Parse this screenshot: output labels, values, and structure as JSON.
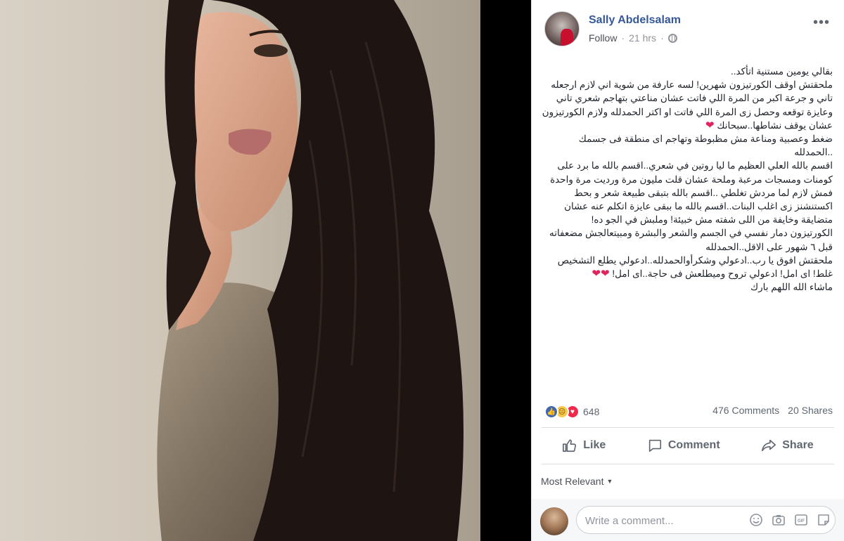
{
  "post": {
    "author": "Sally Abdelsalam",
    "follow_label": "Follow",
    "time": "21 hrs",
    "more_label": "•••",
    "paragraphs": [
      "بقالي يومين مستنية اتأكد..",
      "ملحقتش اوقف الكورتيزون شهرين! لسه عارفة من شوية اني لازم ارجعله تاني و جرعة اكبر من المرة اللي فاتت عشان مناعتي بتهاجم شعري تاني وعايزة توقعه وحصل زى المرة اللي فاتت او اكتر الحمدلله ولازم الكورتيزون عشان يوقف نشاطها..سبحانك",
      "ضغط وعصبية ومناعة مش مظبوطة وتهاجم اى منطقة فى جسمك ..الحمدلله",
      "اقسم بالله العلي العظيم ما ليا روتين في شعري..اقسم بالله ما برد على كومنات ومسجات مرعبة وملحة عشان قلت مليون مرة ورديت مرة واحدة فمش لازم لما مردش تغلطي ..اقسم بالله بتبقى طبيعة شعر و بحط اكستنشنز زى اغلب البنات..اقسم بالله ما ببقى عايزة اتكلم عنه عشان متضايقة وخايفة من اللى شفته مش خبيئة! وملبش في الجو ده!",
      "الكورتيزون دمار نفسي في الجسم والشعر والبشرة ومبيتعالجش مضعفاته قبل ٦ شهور على الاقل..الحمدلله",
      "ملحقتش افوق يا رب..ادعولي وشكرأوالحمدلله..ادعولي يطلع التشخيص غلط! اى امل! ادعولي تروح وميطلعش فى حاجة..اى امل!",
      "ماشاء الله اللهم بارك"
    ]
  },
  "stats": {
    "reaction_count": "648",
    "comments": "476 Comments",
    "shares": "20 Shares"
  },
  "actions": {
    "like": "Like",
    "comment": "Comment",
    "share": "Share"
  },
  "comments": {
    "sort_label": "Most Relevant",
    "placeholder": "Write a comment..."
  },
  "colors": {
    "link": "#365899",
    "like_blue": "#4267b2",
    "heart_red": "#e0245e"
  },
  "icons": [
    "thumbs-up-icon",
    "comment-icon",
    "share-icon",
    "globe-icon",
    "emoji-icon",
    "camera-icon",
    "gif-icon",
    "sticker-icon"
  ]
}
